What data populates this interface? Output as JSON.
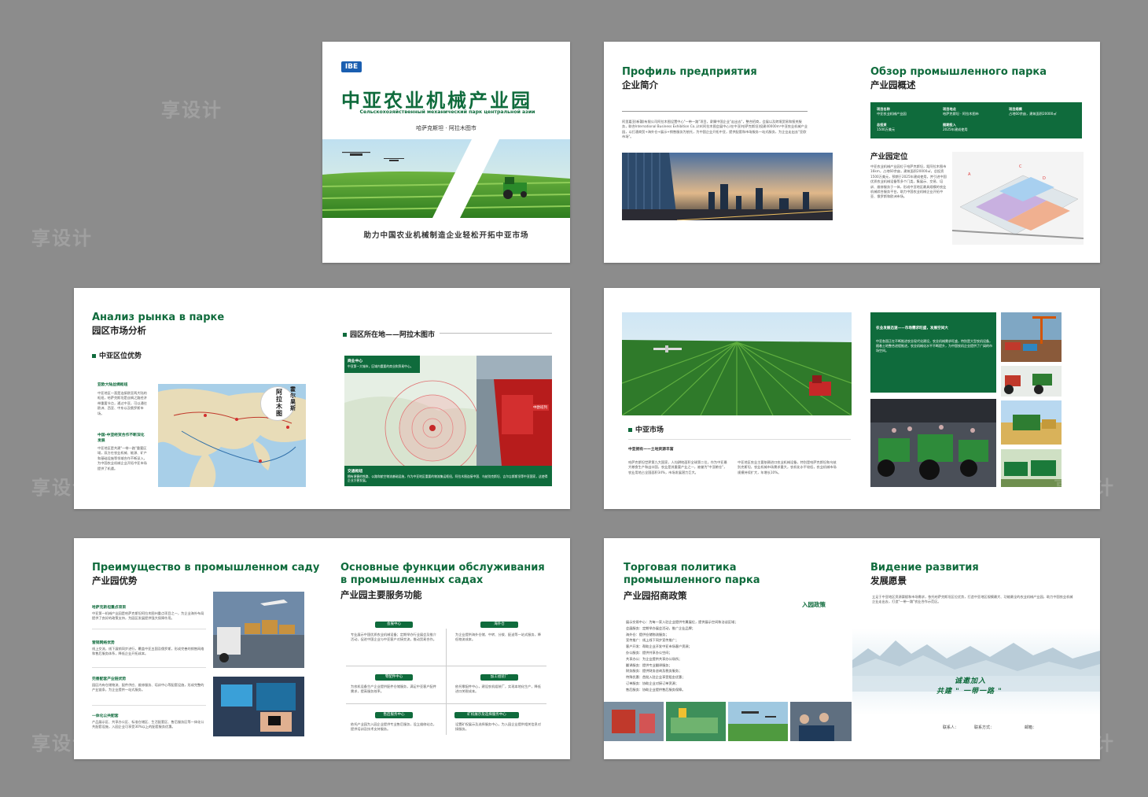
{
  "cover": {
    "logo": "IBE",
    "title_cn": "中亚农业机械产业园",
    "title_ru": "Сельскохозяйственный механический парк центральной азии",
    "location": "哈萨克斯坦 · 阿拉木图市",
    "slogan": "助力中国农业机械制造企业轻松开拓中亚市场"
  },
  "profile": {
    "title_ru": "Профиль предприятия",
    "title_cn": "企业简介",
    "body": "阿里嘉亚(新疆)有限公司阿拉木图设置中心\"一带一路\"项目，隶属中国企业\"走出去\"，整合招商，会展以及跨境贸易和报关服务，联合International Business Exhibition Co.,Ltd(阿拉木图会展中心)在中亚(哈萨克斯坦)投建40000m²中亚农业机械产业园，以打通商贸+海外仓+展示+销售服务为依托，为中国企业开拓中亚，提供配套和市场服务一站式服务，为企业走出去\"亚欧市场\"。"
  },
  "overview": {
    "title_ru": "Обзор промышленного парка",
    "title_cn": "产业园概述",
    "cells": [
      {
        "k": "项目名称",
        "v": "中亚农业机械产业园"
      },
      {
        "k": "项目地点",
        "v": "哈萨克斯坦 · 阿拉木图市"
      },
      {
        "k": "项目规模",
        "v": "占地60余亩，建筑面积20000㎡"
      },
      {
        "k": "总投资",
        "v": "1500万美元"
      },
      {
        "k": "图期投入",
        "v": "2025年建成使用"
      }
    ],
    "position_title": "产业园定位",
    "position_text": "中亚农业机械产业园位于哈萨克斯坦，距阿拉木图市16km，占地60余亩，建筑面积20000㎡，总投资1500万美元，预期于2025年建成使用，并引进中国优质农业机械设备等多个门类，集展示、交易、培训、维修服务于一体，形成中亚地区最具规模的农业机械综合服务平台，助力中国农业机械企业开拓中亚、俄罗斯和欧洲市场。"
  },
  "market": {
    "title_ru": "Анализ рынка в парке",
    "title_cn": "园区市场分析",
    "sub": "中亚区位优势",
    "h1": "亚欧大陆丝绸枢纽",
    "t1": "中亚地区一直是连接欧亚两大陆的枢纽，哈萨克斯坦是丝绸之路经济带重要节点，通过中亚，可以通往欧洲、西亚、中东以及俄罗斯市场。",
    "h2": "中国-中亚经贸合作不断深化发展",
    "t2": "中亚地区是共建\"一带一路\"重要区域，双方在农业机械、能源、矿产和基础设施等领域合作不断深入，为中国农业机械企业开拓中亚市场提供了机遇。",
    "map_label": "阿拉木图",
    "map_label2": "霍尔果斯",
    "loc_sub": "园区所在地——阿拉木图市",
    "loc_h1": "商业中心",
    "loc_t1": "中亚第一大城市，区域内重要的商业和贸易中心。",
    "loc_h2": "交通枢纽",
    "loc_t2": "拥有便捷的铁路、公路和航空物流基础设施，作为中亚地区重要的物流集运枢纽，阿拉木图连接中国、乌兹别克斯坦、吉尔吉斯斯坦等中亚国家，这使得企业方便发展。",
    "train_label": "中欧班列"
  },
  "china_market": {
    "sub": "中亚市场",
    "h": "中亚拥有——土地资源丰富",
    "t1": "哈萨克斯坦世界第九大国家，人均耕地面积全球第二位，作为中亚最大粮食生产和出口国，农业是其重要产业之一，被誉为\"中亚粮仓\"，农业用地占全国面积34%，市场发展潜力巨大。",
    "t2": "中亚地区农业主要依赖进口农业机械设备，特别是哈萨克斯坦和乌兹别克斯坦，农业机械市场需求量大，农机化水平较低，农业机械市场规模持续扩大，年增长10%。",
    "box_h": "农业发展迅速——市场需求旺盛，发展空间大",
    "box_t": "中亚各国正在不断推进农业现代化建设，农业机械需求旺盛，特别是大型农机设备，随着土地整合进程推进，农业机械化水平不断提升，为中国农机企业提供了广阔的市场空间。"
  },
  "advantage": {
    "title_ru": "Преимущество в промышленном саду",
    "title_cn": "产业园优势",
    "items": [
      {
        "h": "哈萨克斯坦重点项目",
        "t": "中亚第一机械产业园是哈萨克斯坦阿拉木图州重点项目之一，为企业海外布局提供了良好的政策支持，为园区发展提供强大保障作用。"
      },
      {
        "h": "营销网络优势",
        "t": "线上交流，线下展销同步进行，覆盖中亚五国及俄罗斯，形成完善的销售网络和售后服务体系，降低企业开拓成本。"
      },
      {
        "h": "完善配套产业链优势",
        "t": "园区内有仓储物流、配件供应、维修服务、培训中心等配套设施，形成完整的产业链条，为企业提供一站式服务。"
      },
      {
        "h": "一体化公共配套",
        "t": "产品展示区、共享办公区、标准仓储区、生活配套区、售后服务区等一体化公共配套设施，入园企业可享受30%以上的配套服务优惠。"
      }
    ]
  },
  "services": {
    "title_ru": "Основные функции обслуживания в промышленных садах",
    "title_cn": "产业园主要服务功能",
    "pills": [
      "会展中心",
      "海外仓",
      "零配件中心",
      "加工组装厂",
      "售后服务中心",
      "矿权展示及选择服务中心"
    ],
    "texts": [
      "专业展示中国优质农业机械设备；定期举办行业展会及推介活动，促进中国企业与中亚客户对接交流，推动贸易合作。",
      "为企业提供海外仓储、中转、分拨、配送等一站式服务，降低物流成本。",
      "为农机设备生产企业提供配件仓储服务，满足中亚客户配件需求，提高服务效率。",
      "依托零配件中心，建设农机组装厂，实现本地化生产，降低进口关税成本。",
      "依托产业园为入园企业提供专业售后服务，设立维修站点，提供培训及技术支持服务。",
      "设置矿权展示及选择服务中心，为入园企业提供相关信息对接服务。"
    ]
  },
  "policy": {
    "title_ru1": "Торговая политика",
    "title_ru2": "промышленного парка",
    "title_cn": "产业园招商政策",
    "right_label": "入园政策",
    "items": [
      "展示交易中心：为每一家入驻企业提供专属展位，提供展示空间和洽谈区域；",
      "会展服务：定期举办展会活动，推广企业品牌；",
      "海外仓：提供仓储物流服务；",
      "宣传推广：线上线下同步宣传推广；",
      "客户开发：帮助企业开发中亚市场客户资源；",
      "办公服务：提供共享办公空间；",
      "共享办公：为企业提供共享办公场所；",
      "翻译服务：提供专业翻译服务；",
      "财务服务：提供财务咨询及税务服务；",
      "特殊优惠：首批入驻企业享受租金优惠；",
      "订单服务：协助企业对接订单资源；",
      "售后服务：协助企业提供售后服务保障。"
    ]
  },
  "vision": {
    "title_ru": "Видение развития",
    "title_cn": "发展愿景",
    "body": "立足于中亚地区资源禀赋和市场需求，依托哈萨克斯坦区位优势，打造中亚地区规模最大、功能最全的农业机械产业园，助力中国农业机械企业走出去，打造\"一带一路\"农业合作示范区。",
    "slogan1": "诚邀加入",
    "slogan2": "共建 \" 一带一路 \"",
    "contact1": "联系人：",
    "contact2": "联系方式：",
    "contact3": "邮箱："
  },
  "watermark": "享设计"
}
